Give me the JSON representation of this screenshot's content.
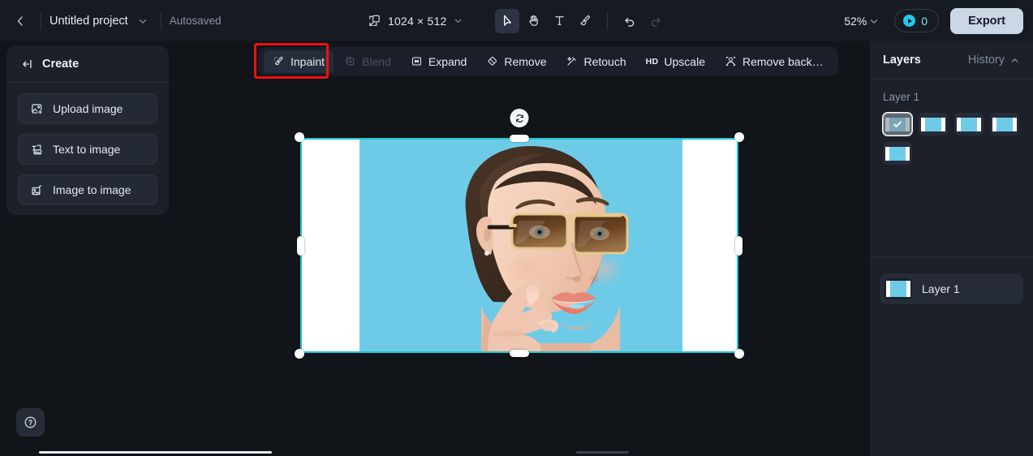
{
  "topbar": {
    "back_icon": "chevron-left-icon",
    "project_title": "Untitled project",
    "project_dropdown_icon": "chevron-down-icon",
    "autosave_status": "Autosaved",
    "canvas_size_icon": "canvas-resize-icon",
    "canvas_size": "1024 × 512",
    "canvas_size_dropdown_icon": "chevron-down-icon",
    "tools": [
      {
        "name": "select-tool",
        "icon": "cursor-arrow-icon",
        "active": true,
        "disabled": false
      },
      {
        "name": "hand-tool",
        "icon": "hand-icon",
        "active": false,
        "disabled": false
      },
      {
        "name": "text-tool",
        "icon": "text-t-icon",
        "active": false,
        "disabled": false
      },
      {
        "name": "brush-tool",
        "icon": "brush-icon",
        "active": false,
        "disabled": false
      },
      {
        "name": "undo-tool",
        "icon": "undo-arrow-icon",
        "active": false,
        "disabled": false
      },
      {
        "name": "redo-tool",
        "icon": "redo-arrow-icon",
        "active": false,
        "disabled": true
      }
    ],
    "zoom_level": "52%",
    "zoom_dropdown_icon": "chevron-down-icon",
    "credits_icon": "credit-coin-icon",
    "credits_count": "0",
    "export_label": "Export"
  },
  "subtoolbar": {
    "items": [
      {
        "label": "Inpaint",
        "icon": "inpaint-brush-icon",
        "state": "selected"
      },
      {
        "label": "Blend",
        "icon": "blend-layers-icon",
        "state": "disabled"
      },
      {
        "label": "Expand",
        "icon": "expand-frame-icon",
        "state": "normal"
      },
      {
        "label": "Remove",
        "icon": "eraser-icon",
        "state": "normal"
      },
      {
        "label": "Retouch",
        "icon": "magic-wand-icon",
        "state": "normal"
      },
      {
        "label": "Upscale",
        "icon": "hd-icon",
        "state": "normal",
        "badge": "HD"
      },
      {
        "label": "Remove back…",
        "icon": "remove-background-icon",
        "state": "normal"
      }
    ],
    "highlight_color": "#f0110f",
    "highlighted_item": "Inpaint"
  },
  "create_panel": {
    "collapse_icon": "collapse-panel-icon",
    "title": "Create",
    "buttons": [
      {
        "label": "Upload image",
        "icon": "upload-image-icon"
      },
      {
        "label": "Text to image",
        "icon": "text-to-image-icon"
      },
      {
        "label": "Image to image",
        "icon": "image-to-image-icon"
      }
    ]
  },
  "canvas": {
    "rotate_handle_icon": "rotate-refresh-icon",
    "selection_color": "#1ec7cf",
    "artwork_background": "#ffffff",
    "photo_background": "#6ecbe8",
    "photo_description": "Portrait of a woman wearing brown-tinted rectangular sunglasses against a light blue background, hand raised to her chin"
  },
  "layers_panel": {
    "tab_layers": "Layers",
    "tab_history": "History",
    "history_chevron_icon": "chevron-up-icon",
    "group_name": "Layer 1",
    "thumbnails": [
      {
        "index": 1,
        "selected": true,
        "check_icon": "check-icon"
      },
      {
        "index": 2,
        "selected": false
      },
      {
        "index": 3,
        "selected": false
      },
      {
        "index": 4,
        "selected": false
      },
      {
        "index": 5,
        "selected": false
      }
    ],
    "layer_rows": [
      {
        "name": "Layer 1",
        "thumb_icon": "layer-thumbnail"
      }
    ]
  },
  "footer": {
    "help_icon": "question-circle-icon",
    "scrollbar": "horizontal-scrollbar"
  }
}
